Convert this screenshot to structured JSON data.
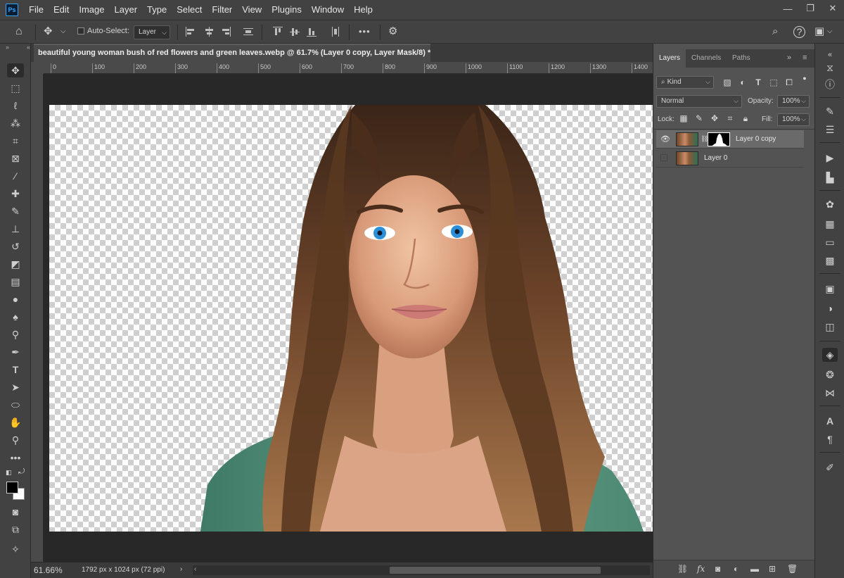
{
  "app": {
    "logo_text": "Ps"
  },
  "menu": [
    "File",
    "Edit",
    "Image",
    "Layer",
    "Type",
    "Select",
    "Filter",
    "View",
    "Plugins",
    "Window",
    "Help"
  ],
  "window_controls": {
    "minimize": "—",
    "restore": "❐",
    "close": "✕"
  },
  "options_bar": {
    "auto_select_label": "Auto-Select:",
    "auto_select_target": "Layer",
    "more_label": "•••"
  },
  "document": {
    "tab_title": "beautiful young woman bush of red flowers and green leaves.webp @ 61.7% (Layer 0 copy, Layer Mask/8) *",
    "close_glyph": "×"
  },
  "ruler": {
    "top_ticks": [
      "0",
      "100",
      "200",
      "300",
      "400",
      "500",
      "600",
      "700",
      "800",
      "900",
      "1000",
      "1100",
      "1200",
      "1300",
      "1400"
    ]
  },
  "status": {
    "zoom": "61.66%",
    "doc_size": "1792 px x 1024 px (72 ppi)"
  },
  "layers_panel": {
    "tabs": [
      "Layers",
      "Channels",
      "Paths"
    ],
    "filter_kind": "Kind",
    "blend_mode": "Normal",
    "opacity_label": "Opacity:",
    "opacity_value": "100%",
    "lock_label": "Lock:",
    "fill_label": "Fill:",
    "fill_value": "100%",
    "layers": [
      {
        "name": "Layer 0 copy",
        "visible": true,
        "selected": true,
        "has_mask": true
      },
      {
        "name": "Layer 0",
        "visible": false,
        "selected": false,
        "has_mask": false
      }
    ]
  },
  "colors": {
    "foreground": "#000000",
    "background": "#ffffff",
    "accent": "#31a8ff"
  }
}
